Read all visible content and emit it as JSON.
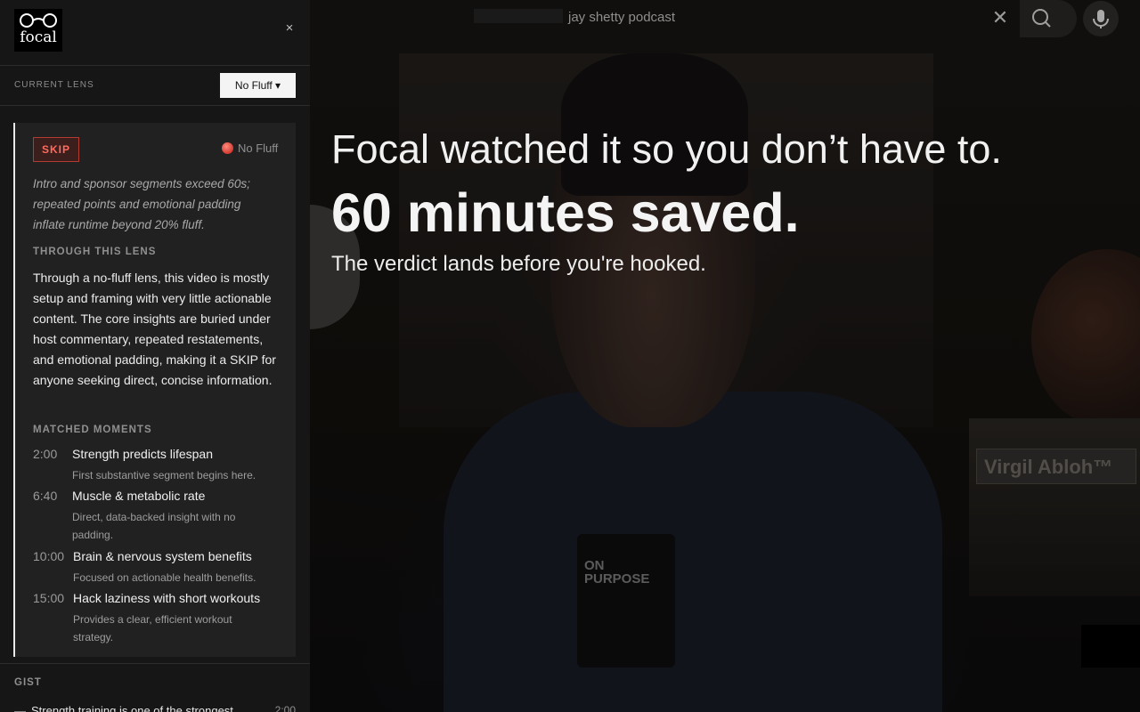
{
  "search": {
    "text": "jay shetty podcast"
  },
  "sidebar": {
    "brand": "focal",
    "close_glyph": "×",
    "lens_label": "CURRENT LENS",
    "lens_value": "No Fluff ▾"
  },
  "verdict": {
    "badge": "SKIP",
    "lens_tag": "No Fluff",
    "reason": "Intro and sponsor segments exceed 60s; repeated points and emotional padding inflate runtime beyond 20% fluff.",
    "through_label": "THROUGH THIS LENS",
    "through_text": "Through a no-fluff lens, this video is mostly setup and framing with very little actionable content. The core insights are buried under host commentary, repeated restatements, and emotional padding, making it a SKIP for anyone seeking direct, concise information.",
    "moments_label": "MATCHED MOMENTS",
    "moments": [
      {
        "time": "2:00",
        "title": "Strength predicts lifespan",
        "desc": "First substantive segment begins here."
      },
      {
        "time": "6:40",
        "title": "Muscle & metabolic rate",
        "desc": "Direct, data-backed insight with no padding."
      },
      {
        "time": "10:00",
        "title": "Brain & nervous system benefits",
        "desc": "Focused on actionable health benefits."
      },
      {
        "time": "15:00",
        "title": "Hack laziness with short workouts",
        "desc": "Provides a clear, efficient workout strategy."
      }
    ]
  },
  "gist": {
    "label": "GIST",
    "items": [
      {
        "text": "Strength training is one of the strongest",
        "time": "2:00"
      }
    ]
  },
  "headline": {
    "line1": "Focal watched it so you don’t have to.",
    "line2": "60 minutes saved.",
    "line3": "The verdict lands before you're hooked."
  },
  "video": {
    "mic_label": "ON PURPOSE",
    "book_text": "Virgil Abloh™"
  },
  "icons": {
    "clear": "close-icon",
    "search": "search-icon",
    "mic": "mic-icon",
    "brand": "glasses-icon"
  },
  "colors": {
    "accent_red": "#ff6b5f",
    "sidebar_bg": "#161616",
    "card_bg": "#212121"
  }
}
